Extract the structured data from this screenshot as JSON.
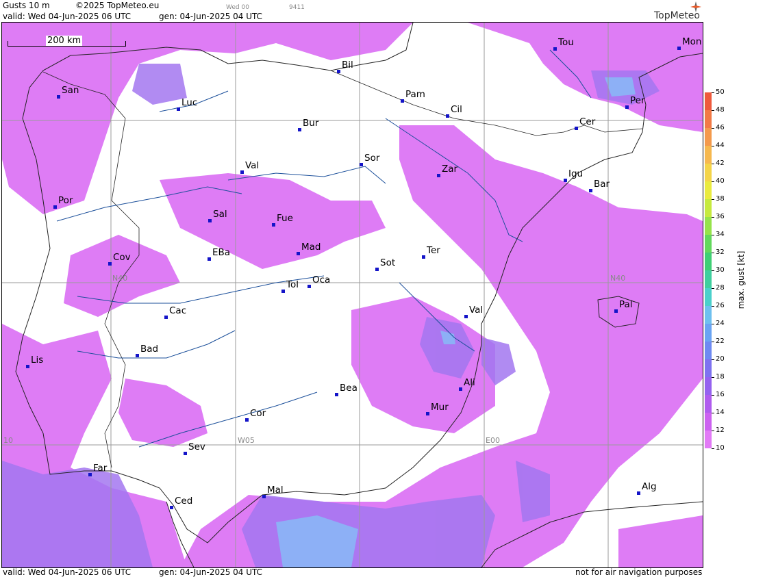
{
  "header": {
    "field": "Gusts 10 m",
    "copyright": "©2025 TopMeteo.eu",
    "run_label": "Wed 00",
    "code": "9411",
    "valid": "valid:  Wed  04-Jun-2025  06 UTC",
    "gen": "gen: 04-Jun-2025 04 UTC",
    "brand": "TopMeteo"
  },
  "footer": {
    "valid": "valid:  Wed  04-Jun-2025  06 UTC",
    "gen": "gen: 04-Jun-2025 04 UTC",
    "disclaimer": "not for air navigation purposes"
  },
  "map": {
    "scale_label": "200 km",
    "grid_labels": {
      "n40_left": "N40",
      "n40_right": "N40",
      "w05": "W05",
      "e00": "E00",
      "w10": "10"
    },
    "cities": [
      {
        "name": "Tou"
      },
      {
        "name": "Mon"
      },
      {
        "name": "Bil"
      },
      {
        "name": "San"
      },
      {
        "name": "Pam"
      },
      {
        "name": "Luc"
      },
      {
        "name": "Per"
      },
      {
        "name": "Cil"
      },
      {
        "name": "Cer"
      },
      {
        "name": "Bur"
      },
      {
        "name": "Sor"
      },
      {
        "name": "Val"
      },
      {
        "name": "Zar"
      },
      {
        "name": "Igu"
      },
      {
        "name": "Bar"
      },
      {
        "name": "Por"
      },
      {
        "name": "Sal"
      },
      {
        "name": "Fue"
      },
      {
        "name": "Mad"
      },
      {
        "name": "Ter"
      },
      {
        "name": "EBa"
      },
      {
        "name": "Cov"
      },
      {
        "name": "Sot"
      },
      {
        "name": "Tol"
      },
      {
        "name": "Oca"
      },
      {
        "name": "Pal"
      },
      {
        "name": "Val"
      },
      {
        "name": "Cac"
      },
      {
        "name": "Bad"
      },
      {
        "name": "Lis"
      },
      {
        "name": "Ali"
      },
      {
        "name": "Bea"
      },
      {
        "name": "Mur"
      },
      {
        "name": "Cor"
      },
      {
        "name": "Sev"
      },
      {
        "name": "Far"
      },
      {
        "name": "Alg"
      },
      {
        "name": "Mal"
      },
      {
        "name": "Ced"
      }
    ]
  },
  "legend": {
    "units": "max. gust  [kt]",
    "ticks": [
      "50",
      "48",
      "46",
      "44",
      "42",
      "40",
      "38",
      "36",
      "34",
      "32",
      "30",
      "28",
      "26",
      "24",
      "22",
      "20",
      "18",
      "16",
      "14",
      "12",
      "10"
    ],
    "colors": [
      "#ee5a3c",
      "#f27a45",
      "#f49a4c",
      "#f6b84e",
      "#f4d448",
      "#eaeb3f",
      "#c6ea3e",
      "#96e34a",
      "#62d85c",
      "#3fcf74",
      "#3fcf9e",
      "#4ad0cb",
      "#6ec0ef",
      "#6aa4f3",
      "#6e8af2",
      "#7e72f0",
      "#9562ef",
      "#b05cee",
      "#cc62f0",
      "#e27af6"
    ]
  }
}
